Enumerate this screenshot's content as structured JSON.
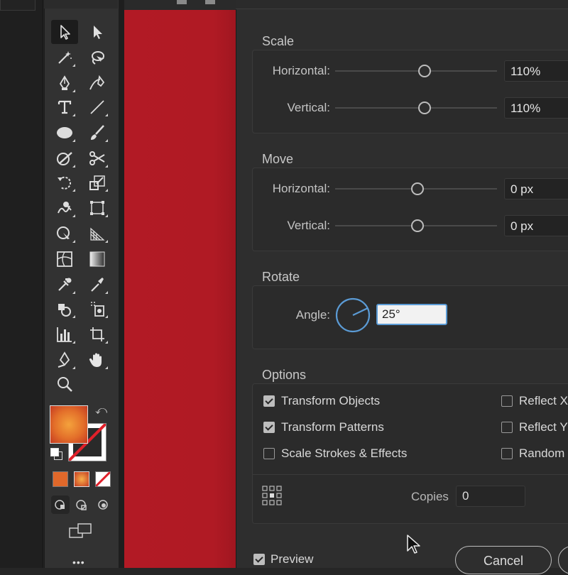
{
  "scale": {
    "title": "Scale",
    "horizontal_label": "Horizontal:",
    "horizontal_value": "110%",
    "vertical_label": "Vertical:",
    "vertical_value": "110%"
  },
  "move": {
    "title": "Move",
    "horizontal_label": "Horizontal:",
    "horizontal_value": "0 px",
    "vertical_label": "Vertical:",
    "vertical_value": "0 px"
  },
  "rotate": {
    "title": "Rotate",
    "angle_label": "Angle:",
    "angle_value": "25°"
  },
  "options": {
    "title": "Options",
    "transform_objects": "Transform Objects",
    "transform_patterns": "Transform Patterns",
    "scale_strokes": "Scale Strokes & Effects",
    "reflect_x": "Reflect X",
    "reflect_y": "Reflect Y",
    "random": "Random",
    "copies_label": "Copies",
    "copies_value": "0",
    "checked": {
      "transform_objects": true,
      "transform_patterns": true,
      "scale_strokes": false,
      "reflect_x": false,
      "reflect_y": false,
      "random": false
    }
  },
  "footer": {
    "preview_label": "Preview",
    "preview_checked": true,
    "cancel_label": "Cancel"
  },
  "colors": {
    "accent": "#5b9bd5",
    "artboard_red": "#b21a25",
    "fill_gradient_center": "#f4a23c",
    "fill_gradient_edge": "#c53a21"
  },
  "toolbar": {
    "icons": [
      "selection-tool-icon",
      "direct-selection-tool-icon",
      "magic-wand-icon",
      "lasso-icon",
      "pen-tool-icon",
      "curvature-tool-icon",
      "type-tool-icon",
      "line-segment-icon",
      "ellipse-tool-icon",
      "paintbrush-icon",
      "shaper-tool-icon",
      "scissors-icon",
      "rotate-tool-icon",
      "scale-tool-icon",
      "warp-tool-icon",
      "free-transform-icon",
      "shape-builder-icon",
      "perspective-grid-icon",
      "mesh-tool-icon",
      "gradient-tool-icon",
      "eyedropper-icon",
      "blend-tool-icon",
      "symbol-sprayer-icon",
      "live-paint-icon",
      "graph-tool-icon",
      "artboard-tool-icon",
      "slice-tool-icon",
      "hand-tool-icon",
      "zoom-tool-icon"
    ],
    "more_label": "•••"
  }
}
